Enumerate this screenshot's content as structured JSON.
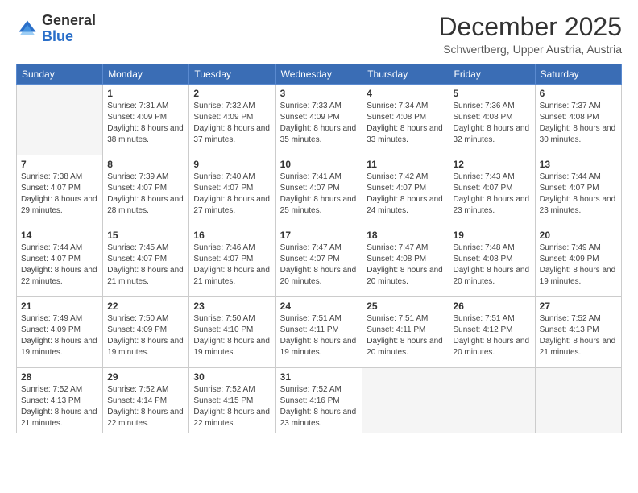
{
  "header": {
    "logo_general": "General",
    "logo_blue": "Blue",
    "month_title": "December 2025",
    "location": "Schwertberg, Upper Austria, Austria"
  },
  "days_of_week": [
    "Sunday",
    "Monday",
    "Tuesday",
    "Wednesday",
    "Thursday",
    "Friday",
    "Saturday"
  ],
  "weeks": [
    [
      {
        "day": "",
        "empty": true
      },
      {
        "day": "1",
        "sunrise": "Sunrise: 7:31 AM",
        "sunset": "Sunset: 4:09 PM",
        "daylight": "Daylight: 8 hours and 38 minutes."
      },
      {
        "day": "2",
        "sunrise": "Sunrise: 7:32 AM",
        "sunset": "Sunset: 4:09 PM",
        "daylight": "Daylight: 8 hours and 37 minutes."
      },
      {
        "day": "3",
        "sunrise": "Sunrise: 7:33 AM",
        "sunset": "Sunset: 4:09 PM",
        "daylight": "Daylight: 8 hours and 35 minutes."
      },
      {
        "day": "4",
        "sunrise": "Sunrise: 7:34 AM",
        "sunset": "Sunset: 4:08 PM",
        "daylight": "Daylight: 8 hours and 33 minutes."
      },
      {
        "day": "5",
        "sunrise": "Sunrise: 7:36 AM",
        "sunset": "Sunset: 4:08 PM",
        "daylight": "Daylight: 8 hours and 32 minutes."
      },
      {
        "day": "6",
        "sunrise": "Sunrise: 7:37 AM",
        "sunset": "Sunset: 4:08 PM",
        "daylight": "Daylight: 8 hours and 30 minutes."
      }
    ],
    [
      {
        "day": "7",
        "sunrise": "Sunrise: 7:38 AM",
        "sunset": "Sunset: 4:07 PM",
        "daylight": "Daylight: 8 hours and 29 minutes."
      },
      {
        "day": "8",
        "sunrise": "Sunrise: 7:39 AM",
        "sunset": "Sunset: 4:07 PM",
        "daylight": "Daylight: 8 hours and 28 minutes."
      },
      {
        "day": "9",
        "sunrise": "Sunrise: 7:40 AM",
        "sunset": "Sunset: 4:07 PM",
        "daylight": "Daylight: 8 hours and 27 minutes."
      },
      {
        "day": "10",
        "sunrise": "Sunrise: 7:41 AM",
        "sunset": "Sunset: 4:07 PM",
        "daylight": "Daylight: 8 hours and 25 minutes."
      },
      {
        "day": "11",
        "sunrise": "Sunrise: 7:42 AM",
        "sunset": "Sunset: 4:07 PM",
        "daylight": "Daylight: 8 hours and 24 minutes."
      },
      {
        "day": "12",
        "sunrise": "Sunrise: 7:43 AM",
        "sunset": "Sunset: 4:07 PM",
        "daylight": "Daylight: 8 hours and 23 minutes."
      },
      {
        "day": "13",
        "sunrise": "Sunrise: 7:44 AM",
        "sunset": "Sunset: 4:07 PM",
        "daylight": "Daylight: 8 hours and 23 minutes."
      }
    ],
    [
      {
        "day": "14",
        "sunrise": "Sunrise: 7:44 AM",
        "sunset": "Sunset: 4:07 PM",
        "daylight": "Daylight: 8 hours and 22 minutes."
      },
      {
        "day": "15",
        "sunrise": "Sunrise: 7:45 AM",
        "sunset": "Sunset: 4:07 PM",
        "daylight": "Daylight: 8 hours and 21 minutes."
      },
      {
        "day": "16",
        "sunrise": "Sunrise: 7:46 AM",
        "sunset": "Sunset: 4:07 PM",
        "daylight": "Daylight: 8 hours and 21 minutes."
      },
      {
        "day": "17",
        "sunrise": "Sunrise: 7:47 AM",
        "sunset": "Sunset: 4:07 PM",
        "daylight": "Daylight: 8 hours and 20 minutes."
      },
      {
        "day": "18",
        "sunrise": "Sunrise: 7:47 AM",
        "sunset": "Sunset: 4:08 PM",
        "daylight": "Daylight: 8 hours and 20 minutes."
      },
      {
        "day": "19",
        "sunrise": "Sunrise: 7:48 AM",
        "sunset": "Sunset: 4:08 PM",
        "daylight": "Daylight: 8 hours and 20 minutes."
      },
      {
        "day": "20",
        "sunrise": "Sunrise: 7:49 AM",
        "sunset": "Sunset: 4:09 PM",
        "daylight": "Daylight: 8 hours and 19 minutes."
      }
    ],
    [
      {
        "day": "21",
        "sunrise": "Sunrise: 7:49 AM",
        "sunset": "Sunset: 4:09 PM",
        "daylight": "Daylight: 8 hours and 19 minutes."
      },
      {
        "day": "22",
        "sunrise": "Sunrise: 7:50 AM",
        "sunset": "Sunset: 4:09 PM",
        "daylight": "Daylight: 8 hours and 19 minutes."
      },
      {
        "day": "23",
        "sunrise": "Sunrise: 7:50 AM",
        "sunset": "Sunset: 4:10 PM",
        "daylight": "Daylight: 8 hours and 19 minutes."
      },
      {
        "day": "24",
        "sunrise": "Sunrise: 7:51 AM",
        "sunset": "Sunset: 4:11 PM",
        "daylight": "Daylight: 8 hours and 19 minutes."
      },
      {
        "day": "25",
        "sunrise": "Sunrise: 7:51 AM",
        "sunset": "Sunset: 4:11 PM",
        "daylight": "Daylight: 8 hours and 20 minutes."
      },
      {
        "day": "26",
        "sunrise": "Sunrise: 7:51 AM",
        "sunset": "Sunset: 4:12 PM",
        "daylight": "Daylight: 8 hours and 20 minutes."
      },
      {
        "day": "27",
        "sunrise": "Sunrise: 7:52 AM",
        "sunset": "Sunset: 4:13 PM",
        "daylight": "Daylight: 8 hours and 21 minutes."
      }
    ],
    [
      {
        "day": "28",
        "sunrise": "Sunrise: 7:52 AM",
        "sunset": "Sunset: 4:13 PM",
        "daylight": "Daylight: 8 hours and 21 minutes."
      },
      {
        "day": "29",
        "sunrise": "Sunrise: 7:52 AM",
        "sunset": "Sunset: 4:14 PM",
        "daylight": "Daylight: 8 hours and 22 minutes."
      },
      {
        "day": "30",
        "sunrise": "Sunrise: 7:52 AM",
        "sunset": "Sunset: 4:15 PM",
        "daylight": "Daylight: 8 hours and 22 minutes."
      },
      {
        "day": "31",
        "sunrise": "Sunrise: 7:52 AM",
        "sunset": "Sunset: 4:16 PM",
        "daylight": "Daylight: 8 hours and 23 minutes."
      },
      {
        "day": "",
        "empty": true
      },
      {
        "day": "",
        "empty": true
      },
      {
        "day": "",
        "empty": true
      }
    ]
  ]
}
